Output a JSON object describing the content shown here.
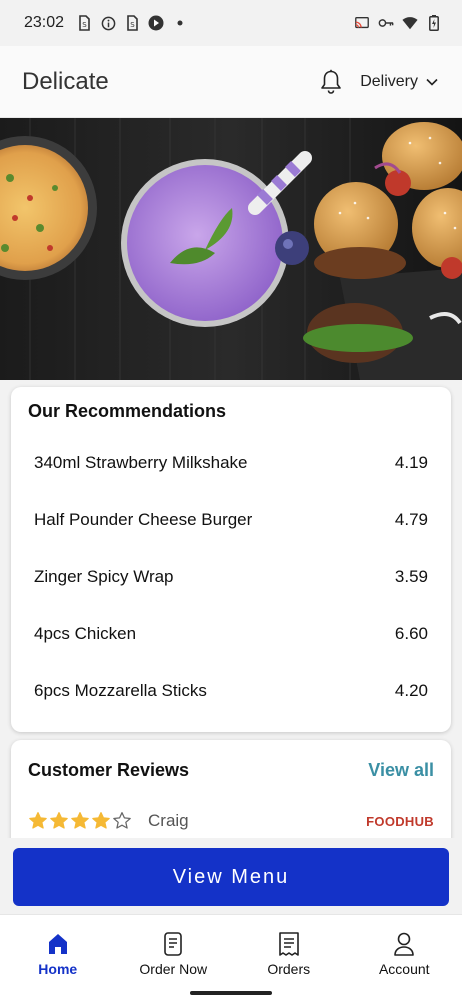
{
  "status_bar": {
    "time": "23:02",
    "left_icons": [
      "sim-icon",
      "info-icon",
      "sim-icon",
      "play-icon",
      "dot-icon"
    ],
    "right_icons": [
      "cast-icon",
      "vpn-key-icon",
      "wifi-icon",
      "battery-icon"
    ]
  },
  "header": {
    "brand": "Delicate",
    "bell_icon": "bell-icon",
    "delivery_label": "Delivery",
    "dropdown_icon": "chevron-down-icon"
  },
  "recommendations": {
    "title": "Our Recommendations",
    "items": [
      {
        "name": "340ml Strawberry Milkshake",
        "price": "4.19"
      },
      {
        "name": "Half Pounder Cheese Burger",
        "price": "4.79"
      },
      {
        "name": "Zinger Spicy Wrap",
        "price": "3.59"
      },
      {
        "name": "4pcs Chicken",
        "price": "6.60"
      },
      {
        "name": "6pcs Mozzarella Sticks",
        "price": "4.20"
      }
    ]
  },
  "reviews": {
    "title": "Customer Reviews",
    "view_all": "View all",
    "items": [
      {
        "reviewer": "Craig",
        "rating": 4,
        "max_rating": 5,
        "source": "FOODHUB"
      }
    ]
  },
  "view_menu_label": "View Menu",
  "colors": {
    "primary": "#1432c8",
    "link": "#3a8fa4",
    "star": "#f5b935",
    "foodhub": "#c0392b"
  },
  "bottom_nav": {
    "items": [
      {
        "label": "Home",
        "icon": "home-icon",
        "active": true
      },
      {
        "label": "Order Now",
        "icon": "order-icon",
        "active": false
      },
      {
        "label": "Orders",
        "icon": "receipt-icon",
        "active": false
      },
      {
        "label": "Account",
        "icon": "account-icon",
        "active": false
      }
    ]
  }
}
